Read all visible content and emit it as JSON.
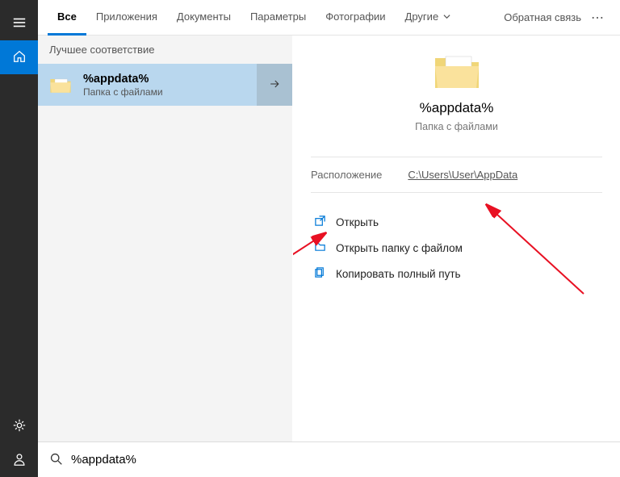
{
  "rail": {
    "hamburger": "menu",
    "home": "home",
    "settings": "settings",
    "profile": "profile"
  },
  "tabs": {
    "all": "Все",
    "apps": "Приложения",
    "docs": "Документы",
    "params": "Параметры",
    "photos": "Фотографии",
    "other": "Другие",
    "feedback": "Обратная связь",
    "more": "⋯"
  },
  "left": {
    "section_best": "Лучшее соответствие",
    "result": {
      "title": "%appdata%",
      "sub": "Папка с файлами"
    }
  },
  "right": {
    "title": "%appdata%",
    "sub": "Папка с файлами",
    "location_label": "Расположение",
    "location_value": "C:\\Users\\User\\AppData",
    "action_open": "Открыть",
    "action_open_folder": "Открыть папку с файлом",
    "action_copy_path": "Копировать полный путь"
  },
  "search": {
    "value": "%appdata%"
  }
}
